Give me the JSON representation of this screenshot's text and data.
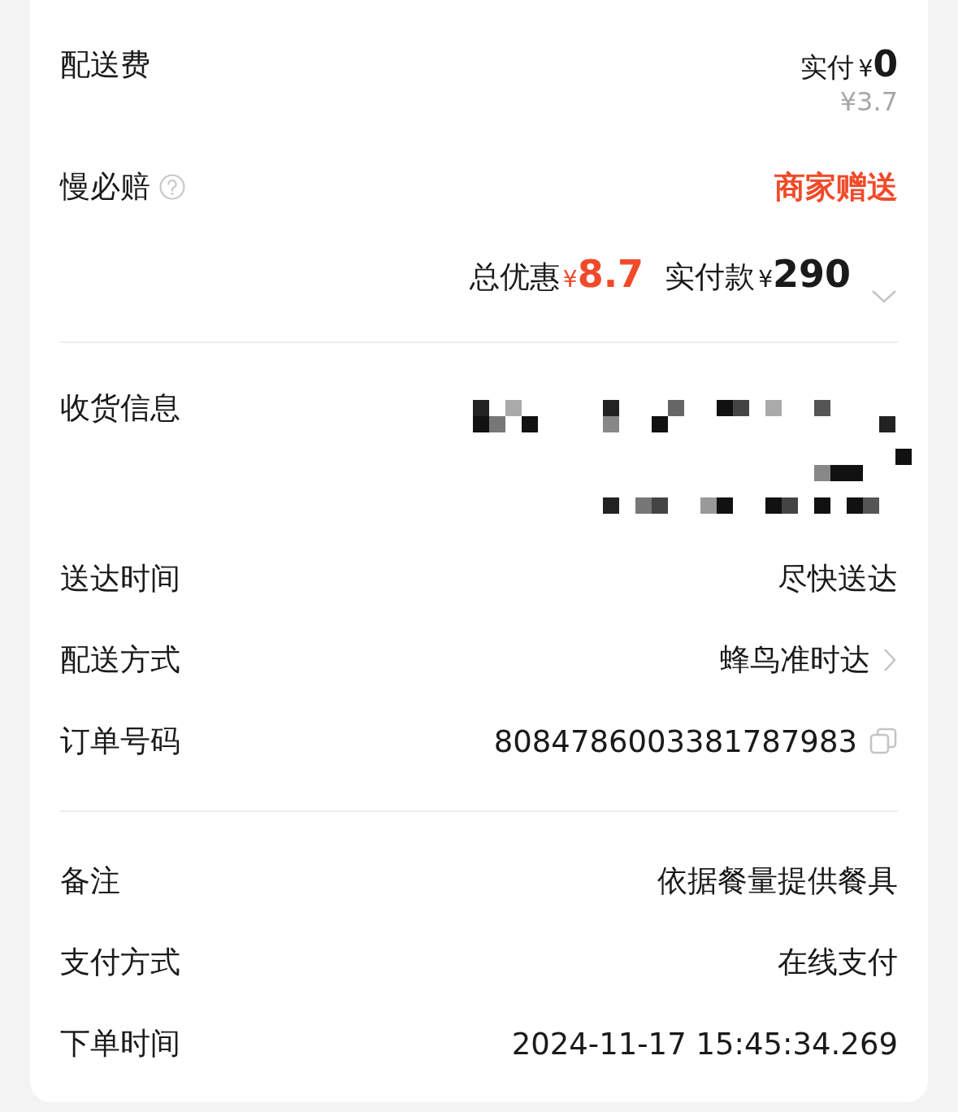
{
  "delivery_fee": {
    "label": "配送费",
    "paid_label": "实付",
    "currency": "¥",
    "paid_amount": "0",
    "original_price": "¥3.7"
  },
  "late_compensation": {
    "label": "慢必赔",
    "value": "商家赠送"
  },
  "summary": {
    "discount_label": "总优惠",
    "discount_currency": "¥",
    "discount_amount": "8.7",
    "paid_label": "实付款",
    "paid_currency": "¥",
    "paid_amount": "290"
  },
  "receiver": {
    "label": "收货信息"
  },
  "details": [
    {
      "label": "送达时间",
      "value": "尽快送达",
      "kind": "plain"
    },
    {
      "label": "配送方式",
      "value": "蜂鸟准时达",
      "kind": "link"
    },
    {
      "label": "订单号码",
      "value": "8084786003381787983",
      "kind": "copy"
    }
  ],
  "extra": [
    {
      "label": "备注",
      "value": "依据餐量提供餐具"
    },
    {
      "label": "支付方式",
      "value": "在线支付"
    },
    {
      "label": "下单时间",
      "value": "2024-11-17 15:45:34.269"
    }
  ]
}
